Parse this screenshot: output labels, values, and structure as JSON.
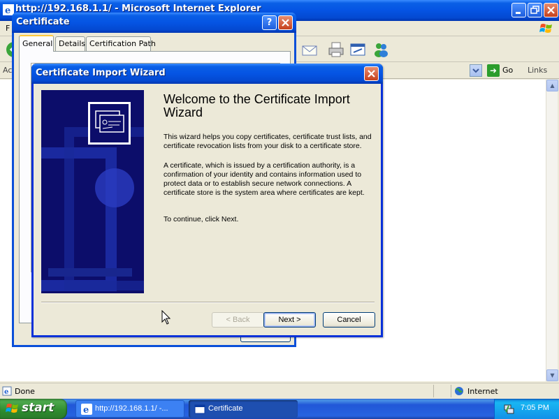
{
  "ie_window": {
    "title": "http://192.168.1.1/ - Microsoft Internet Explorer",
    "menu_first_letter": "F",
    "address_label": "Ac",
    "go_label": "Go",
    "links_label": "Links",
    "status_text": "Done",
    "zone_text": "Internet"
  },
  "certificate_dialog": {
    "title": "Certificate",
    "help_symbol": "?",
    "tabs": [
      {
        "label": "General",
        "active": true
      },
      {
        "label": "Details",
        "active": false
      },
      {
        "label": "Certification Path",
        "active": false
      }
    ]
  },
  "wizard": {
    "title": "Certificate Import Wizard",
    "heading": "Welcome to the Certificate Import Wizard",
    "paragraphs": [
      "This wizard helps you copy certificates, certificate trust lists, and certificate revocation lists from your disk to a certificate store.",
      "A certificate, which is issued by a certification authority, is a confirmation of your identity and contains information used to protect data or to establish secure network connections. A certificate store is the system area where certificates are kept.",
      "To continue, click Next."
    ],
    "buttons": {
      "back": "< Back",
      "next": "Next >",
      "cancel": "Cancel"
    },
    "back_enabled": false
  },
  "taskbar": {
    "start_label": "start",
    "tasks": [
      {
        "label": "http://192.168.1.1/ -...",
        "icon": "ie-icon",
        "active": false
      },
      {
        "label": "Certificate",
        "icon": "window-icon",
        "active": true
      }
    ],
    "clock": "7:05 PM"
  },
  "colors": {
    "titlebar_blue": "#0554e3",
    "dialog_bg": "#ece9d8",
    "banner_navy": "#0c0d6a",
    "taskbar_blue": "#2157d7",
    "start_green": "#3c8d3c",
    "tray_blue": "#139bea"
  }
}
